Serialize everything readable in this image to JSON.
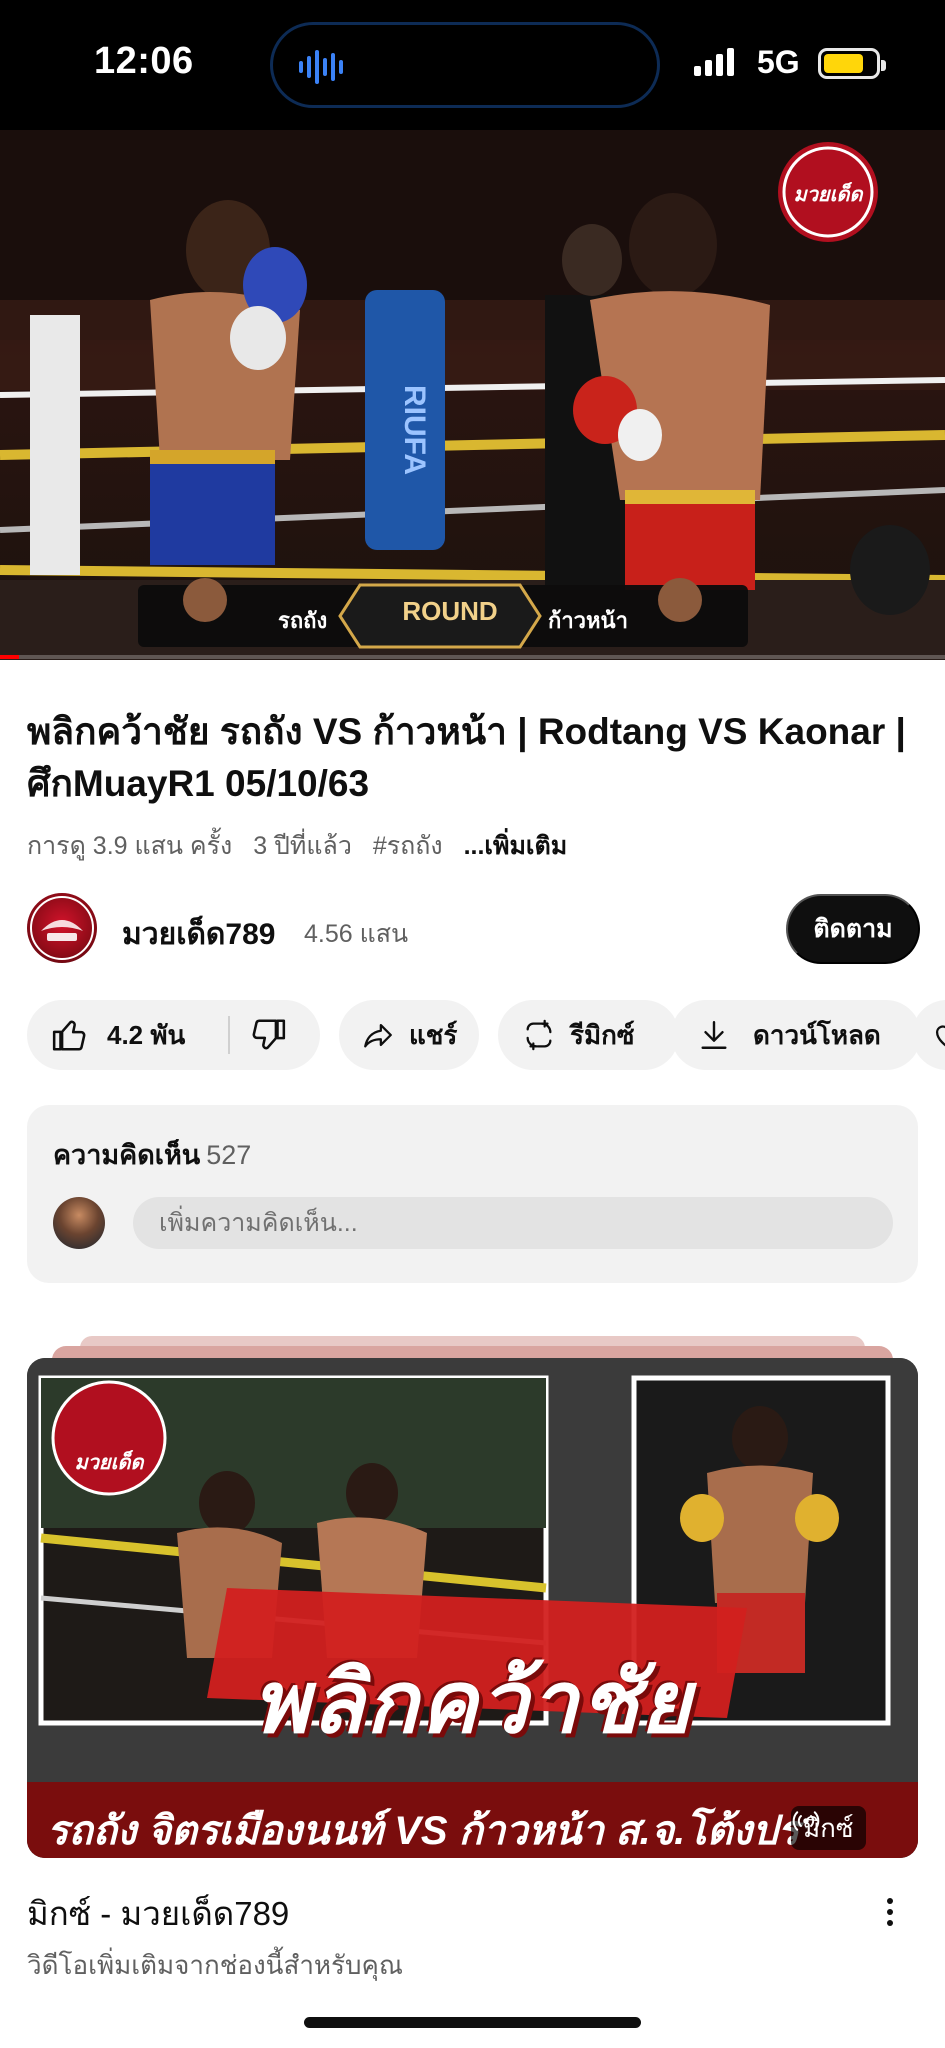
{
  "status_bar": {
    "time": "12:06",
    "network": "5G",
    "battery_level_pct": 78,
    "battery_color": "#ffd60a"
  },
  "player": {
    "overlay": {
      "left_name": "รถถัง",
      "center": "ROUND",
      "right_name": "ก้าวหน้า",
      "corner_logo": "มวยเด็ด"
    },
    "progress_fraction": 0.02,
    "progress_color": "#ff0000"
  },
  "video": {
    "title": "พลิกคว้าชัย  รถถัง   VS ก้าวหน้า  | Rodtang VS Kaonar | ศึกMuayR1 05/10/63",
    "views": "การดู 3.9 แสน ครั้ง",
    "age": "3 ปีที่แล้ว",
    "hashtag": "#รถถัง",
    "more": "...เพิ่มเติม"
  },
  "channel": {
    "name": "มวยเด็ด789",
    "subscribers": "4.56 แสน",
    "subscribe_label": "ติดตาม",
    "avatar_icon": "channel-logo"
  },
  "actions": {
    "likes": "4.2 พัน",
    "share": "แชร์",
    "remix": "รีมิกซ์",
    "download": "ดาวน์โหลด"
  },
  "comments": {
    "label": "ความคิดเห็น",
    "count": "527",
    "placeholder": "เพิ่มความคิดเห็น..."
  },
  "recommendation": {
    "thumbnail_headline": "พลิกคว้าชัย",
    "thumbnail_strip": "รถถัง จิตรเมืองนนท์ VS ก้าวหน้า ส.จ.โต้งปราจีน",
    "thumbnail_logo": "มวยเด็ด",
    "badge": "มิกซ์",
    "title": "มิกซ์ - มวยเด็ด789",
    "subtitle": "วิดีโอเพิ่มเติมจากช่องนี้สำหรับคุณ"
  },
  "colors": {
    "brand_red": "#ff0000",
    "text_primary": "#0f0f0f",
    "text_secondary": "#606060",
    "chip_bg": "#f2f2f2"
  }
}
